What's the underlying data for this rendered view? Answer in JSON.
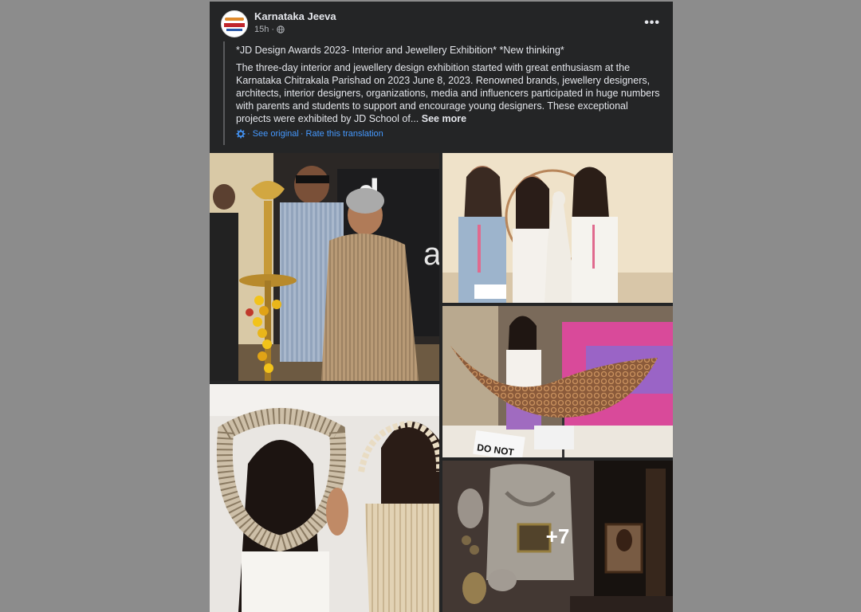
{
  "post": {
    "page_name": "Karnataka Jeeva",
    "time": "15h",
    "dot": "·",
    "title": "*JD Design Awards 2023- Interior and Jewellery Exhibition* *New thinking*",
    "body": "The three-day interior and jewellery design exhibition started with great enthusiasm at the Karnataka Chitrakala Parishad on 2023 June 8, 2023. Renowned brands, jewellery designers, architects, interior designers, organizations, media and influencers participated in huge numbers with parents and students to support and encourage young designers. These exceptional projects were exhibited by JD School of...",
    "see_more": "See more",
    "see_original": "· See original",
    "rate_translation": "· Rate this translation",
    "more_photos": "+7",
    "photo_sign": "DO NOT",
    "icons": {
      "avatar": "page-logo",
      "globe": "globe-icon",
      "more": "more-options-icon",
      "gear": "gear-icon"
    },
    "colors": {
      "background": "#242526",
      "text": "#e4e6eb",
      "link": "#4599ff",
      "secondary": "#b0b3b8"
    }
  }
}
